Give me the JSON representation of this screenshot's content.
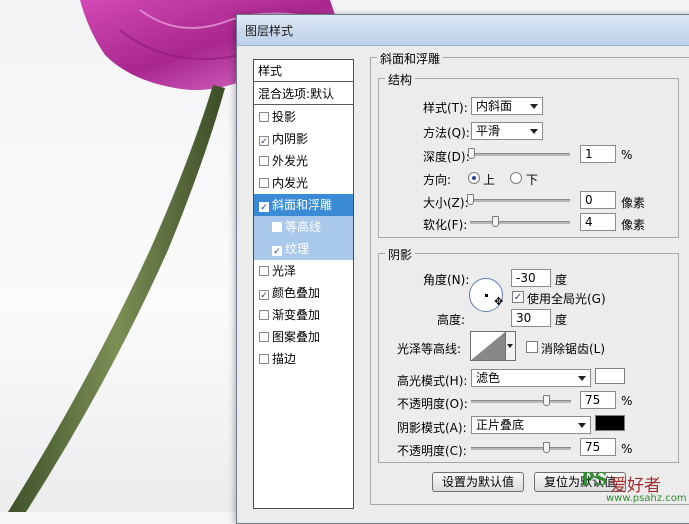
{
  "dialog": {
    "title": "图层样式"
  },
  "styles_list": {
    "header": "样式",
    "blend_options": "混合选项:默认",
    "items": [
      {
        "label": "投影",
        "checked": false
      },
      {
        "label": "内阴影",
        "checked": true
      },
      {
        "label": "外发光",
        "checked": false
      },
      {
        "label": "内发光",
        "checked": false
      },
      {
        "label": "斜面和浮雕",
        "checked": true,
        "selected": true
      },
      {
        "label": "等高线",
        "checked": false,
        "sub": true
      },
      {
        "label": "纹理",
        "checked": true,
        "sub": true
      },
      {
        "label": "光泽",
        "checked": false
      },
      {
        "label": "颜色叠加",
        "checked": true
      },
      {
        "label": "渐变叠加",
        "checked": false
      },
      {
        "label": "图案叠加",
        "checked": false
      },
      {
        "label": "描边",
        "checked": false
      }
    ],
    "check_mark": "✓"
  },
  "bevel": {
    "title": "斜面和浮雕",
    "structure": {
      "title": "结构",
      "style_label": "样式(T):",
      "style_value": "内斜面",
      "technique_label": "方法(Q):",
      "technique_value": "平滑",
      "depth_label": "深度(D):",
      "depth_value": "1",
      "depth_unit": "%",
      "depth_level": 0.01,
      "direction_label": "方向:",
      "direction_up": "上",
      "direction_down": "下",
      "size_label": "大小(Z):",
      "size_value": "0",
      "size_unit": "像素",
      "size_level": 0.0,
      "soften_label": "软化(F):",
      "soften_value": "4",
      "soften_unit": "像素",
      "soften_level": 0.25
    },
    "shading": {
      "title": "阴影",
      "angle_label": "角度(N):",
      "angle_value": "-30",
      "angle_unit": "度",
      "global_light_label": "使用全局光(G)",
      "altitude_label": "高度:",
      "altitude_value": "30",
      "altitude_unit": "度",
      "gloss_contour_label": "光泽等高线:",
      "anti_alias_label": "消除锯齿(L)",
      "highlight_mode_label": "高光模式(H):",
      "highlight_mode_value": "滤色",
      "highlight_color": "#ffffff",
      "highlight_opacity_label": "不透明度(O):",
      "highlight_opacity_value": "75",
      "highlight_opacity_unit": "%",
      "highlight_opacity_level": 0.75,
      "shadow_mode_label": "阴影模式(A):",
      "shadow_mode_value": "正片叠底",
      "shadow_color": "#000000",
      "shadow_opacity_label": "不透明度(C):",
      "shadow_opacity_value": "75",
      "shadow_opacity_unit": "%",
      "shadow_opacity_level": 0.75
    },
    "buttons": {
      "make_default": "设置为默认值",
      "reset_default": "复位为默认值"
    }
  },
  "watermark": {
    "ps": "PS",
    "site_cn": "爱好者",
    "url": "www.psahz.com"
  },
  "colors": {
    "selection": "#3b8ad6",
    "flower": "#c23fa8",
    "stem": "#5b6e3c"
  }
}
